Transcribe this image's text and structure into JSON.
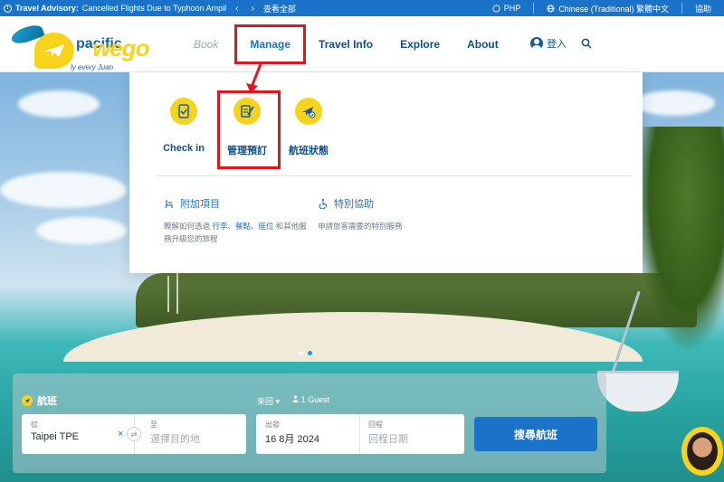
{
  "topbar": {
    "advisory_label": "Travel Advisory:",
    "advisory_text": "Cancelled Flights Due to Typhoon Ampil",
    "prev": "‹",
    "next": "›",
    "view_all": "查看全部",
    "currency": "PHP",
    "language": "Chinese (Traditional) 繁體中文",
    "help": "協助"
  },
  "header": {
    "brand": "pacific",
    "wego": "wego",
    "tagline": "ly every Juan",
    "nav": {
      "book": "Book",
      "manage": "Manage",
      "travel_info": "Travel Info",
      "explore": "Explore",
      "about": "About"
    },
    "login": "登入"
  },
  "dropdown": {
    "tiles": [
      {
        "label": "Check in"
      },
      {
        "label": "管理預訂"
      },
      {
        "label": "航班狀態"
      }
    ],
    "extras": [
      {
        "title": "附加項目",
        "desc_pre": "瞭解如何透過 ",
        "desc_hi": "行李、餐點、座位",
        "desc_post": " 和其他服",
        "desc_line2": "務升級您的旅程"
      },
      {
        "title": "特別協助",
        "desc": "申請旅客需要的特別服務"
      }
    ]
  },
  "search": {
    "flight_tab": "航班",
    "trip_type": "來回",
    "guests": "1 Guest",
    "from_label": "從",
    "from_value": "Taipei TPE",
    "clear": "×",
    "swap": "⇄",
    "to_label": "至",
    "to_placeholder": "選擇目的地",
    "depart_label": "出發",
    "depart_value": "16 8月 2024",
    "return_label": "回程",
    "return_placeholder": "回程日期",
    "button": "搜尋航班"
  },
  "colors": {
    "primary": "#1a73c8",
    "accent": "#f7d31c",
    "highlight": "#e0161c",
    "navy": "#0d4f8b"
  }
}
